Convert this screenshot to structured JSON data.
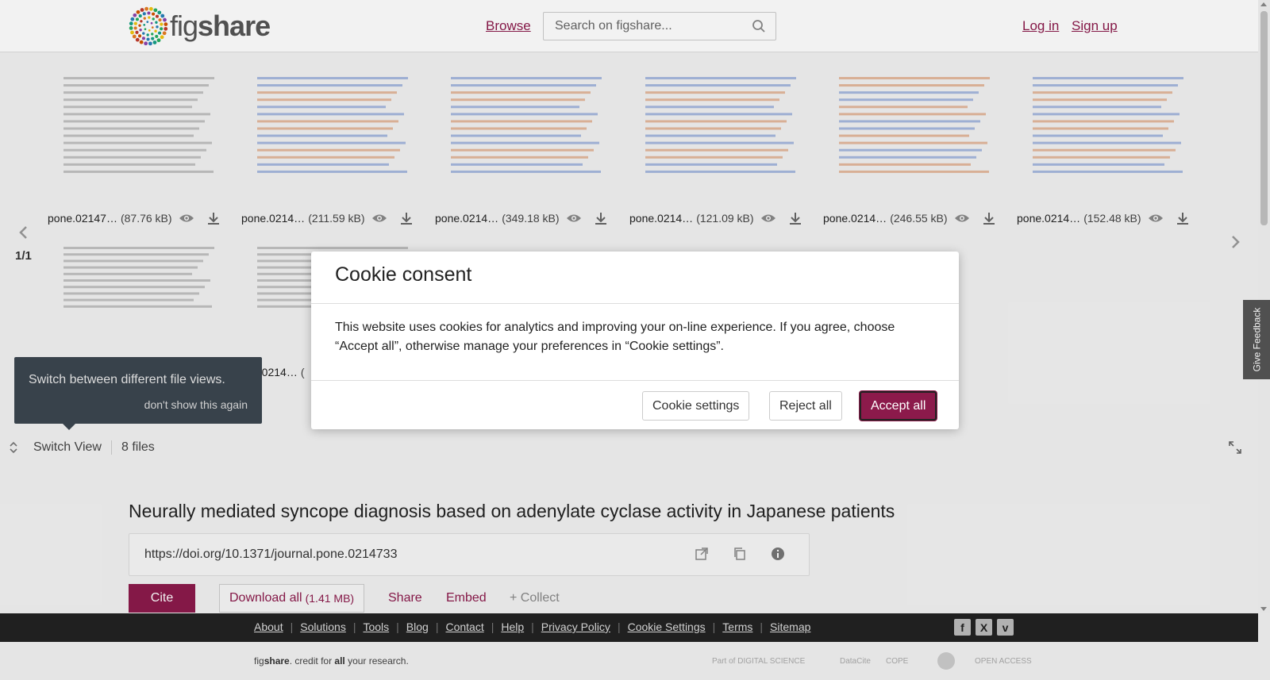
{
  "header": {
    "logo_text_light": "fig",
    "logo_text_bold": "share",
    "browse": "Browse",
    "search_placeholder": "Search on figshare...",
    "login": "Log in",
    "signup": "Sign up"
  },
  "viewer": {
    "files": [
      {
        "name": "pone.02147…",
        "size": "(87.76 kB)"
      },
      {
        "name": "pone.0214…",
        "size": "(211.59 kB)"
      },
      {
        "name": "pone.0214…",
        "size": "(349.18 kB)"
      },
      {
        "name": "pone.0214…",
        "size": "(121.09 kB)"
      },
      {
        "name": "pone.0214…",
        "size": "(246.55 kB)"
      },
      {
        "name": "pone.0214…",
        "size": "(152.48 kB)"
      },
      {
        "name": "",
        "size": ""
      },
      {
        "name": "e.0214…",
        "size": "("
      }
    ],
    "page_indicator": "1/1",
    "tooltip_text": "Switch between different file views.",
    "tooltip_dismiss": "don't show this again",
    "switch_view": "Switch View",
    "file_count": "8 files"
  },
  "main": {
    "title": "Neurally mediated syncope diagnosis based on adenylate cyclase activity in Japanese patients",
    "doi": "https://doi.org/10.1371/journal.pone.0214733",
    "cite": "Cite",
    "download_all": "Download all",
    "download_size": "(1.41 MB)",
    "share": "Share",
    "embed": "Embed",
    "collect": "+ Collect"
  },
  "footer": {
    "links": [
      "About",
      "Solutions",
      "Tools",
      "Blog",
      "Contact",
      "Help",
      "Privacy Policy",
      "Cookie Settings",
      "Terms",
      "Sitemap"
    ],
    "tagline_pre": "fig",
    "tagline_bold": "share",
    "tagline_mid": ". credit for ",
    "tagline_all": "all",
    "tagline_post": " your research.",
    "partners": [
      "Part of DIGITAL SCIENCE",
      "DataCite",
      "COPE",
      "",
      "OPEN ACCESS"
    ]
  },
  "feedback": "Give Feedback",
  "cookie": {
    "title": "Cookie consent",
    "body": "This website uses cookies for analytics and improving your on-line experience. If you agree, choose “Accept all”, otherwise manage your preferences in “Cookie settings”.",
    "settings": "Cookie settings",
    "reject": "Reject all",
    "accept": "Accept all"
  },
  "colors": {
    "brand": "#8c1a4b",
    "footer_bg": "#222222",
    "tooltip_bg": "#3c4650"
  }
}
